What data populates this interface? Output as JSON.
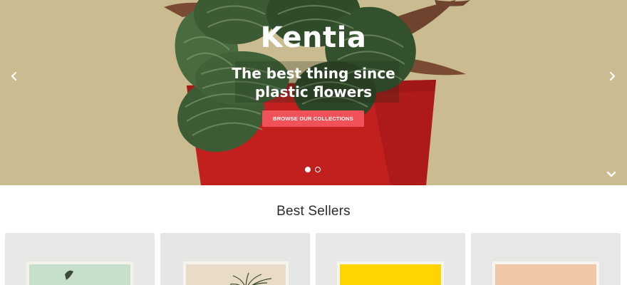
{
  "hero": {
    "title": "Kentia",
    "subtitle": "The best thing since plastic flowers",
    "cta_label": "BROWSE OUR COLLECTIONS",
    "background_color": "#c9b88e",
    "pot_color": "#c21f1f",
    "accent_color": "#f0525a",
    "slides": {
      "count": 2,
      "active": 1
    }
  },
  "icons": {
    "prev": "chevron-left-icon",
    "next": "chevron-right-icon",
    "scroll": "chevron-down-icon"
  },
  "best_sellers": {
    "title": "Best Sellers",
    "products": [
      {
        "poster_color": "#c7e0cc"
      },
      {
        "poster_color": "#e8dcc8"
      },
      {
        "poster_color": "#ffd400"
      },
      {
        "poster_color": "#f1c6a6"
      }
    ]
  }
}
